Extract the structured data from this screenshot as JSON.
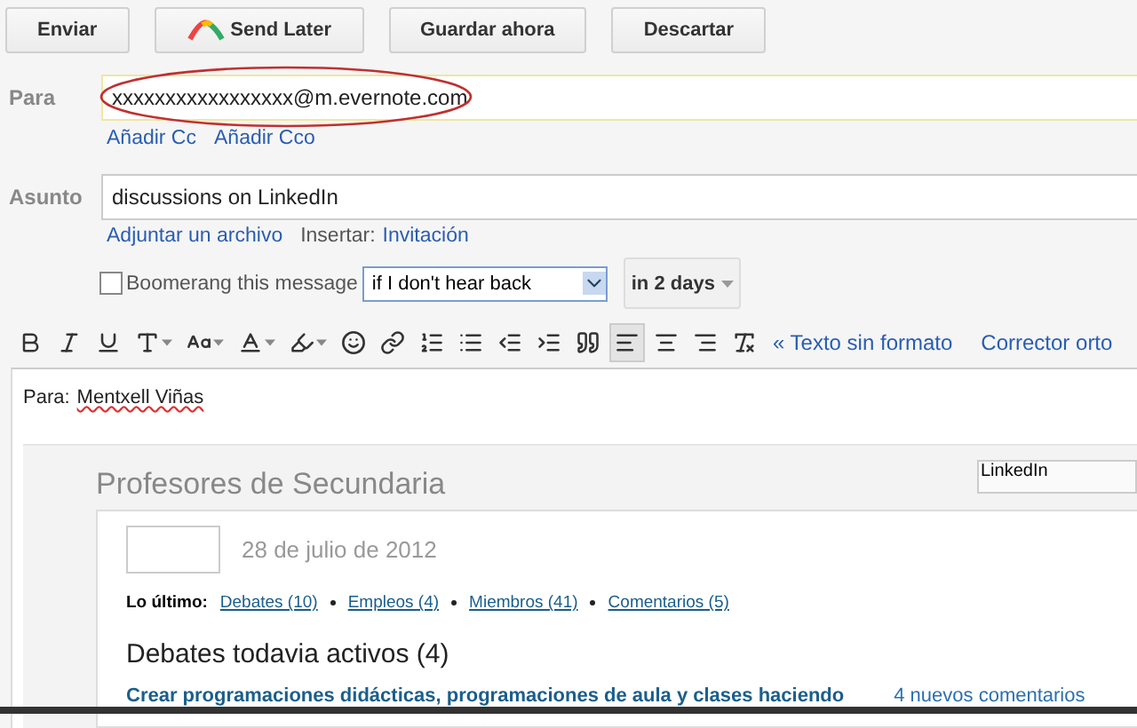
{
  "toolbar": {
    "buttons": [
      {
        "label": "Enviar",
        "kind": "plain"
      },
      {
        "label": "Send Later",
        "kind": "logo"
      },
      {
        "label": "Guardar ahora",
        "kind": "plain"
      },
      {
        "label": "Descartar",
        "kind": "plain"
      }
    ]
  },
  "to": {
    "label": "Para",
    "value": "xxxxxxxxxxxxxxxxx@m.evernote.com",
    "highlighted": true,
    "links": [
      "Añadir Cc",
      "Añadir Cco"
    ]
  },
  "subject": {
    "label": "Asunto",
    "value": "discussions on LinkedIn",
    "attach_link": "Adjuntar un archivo",
    "insert_label": "Insertar:",
    "insert_link": "Invitación"
  },
  "boomerang": {
    "checked": false,
    "label": "Boomerang this message",
    "condition": "if I don't hear back",
    "delay": "in 2 days"
  },
  "format_toolbar": {
    "buttons": [
      {
        "kind": "bold",
        "menu": false,
        "selected": false
      },
      {
        "kind": "italic",
        "menu": false,
        "selected": false
      },
      {
        "kind": "underline",
        "menu": false,
        "selected": false
      },
      {
        "kind": "font",
        "menu": true,
        "selected": false
      },
      {
        "kind": "size",
        "menu": true,
        "selected": false
      },
      {
        "kind": "color",
        "menu": true,
        "selected": false
      },
      {
        "kind": "highlight",
        "menu": true,
        "selected": false
      },
      {
        "kind": "emoji",
        "menu": false,
        "selected": false
      },
      {
        "kind": "link",
        "menu": false,
        "selected": false
      },
      {
        "kind": "numbered",
        "menu": false,
        "selected": false
      },
      {
        "kind": "bullets",
        "menu": false,
        "selected": false
      },
      {
        "kind": "outdent",
        "menu": false,
        "selected": false
      },
      {
        "kind": "indent",
        "menu": false,
        "selected": false
      },
      {
        "kind": "quote",
        "menu": false,
        "selected": false
      },
      {
        "kind": "align-left",
        "menu": false,
        "selected": true
      },
      {
        "kind": "align-center",
        "menu": false,
        "selected": false
      },
      {
        "kind": "align-right",
        "menu": false,
        "selected": false
      },
      {
        "kind": "clear",
        "menu": false,
        "selected": false
      }
    ],
    "links": [
      "« Texto sin formato",
      "Corrector orto"
    ]
  },
  "body": {
    "to_label": "Para:",
    "to_name": "Mentxell Viñas",
    "group": {
      "title": "Profesores de Secundaria",
      "badge": "LinkedIn",
      "date": "28 de julio de 2012",
      "latest_label": "Lo último:",
      "latest_links": [
        "Debates (10)",
        "Empleos (4)",
        "Miembros (41)",
        "Comentarios (5)"
      ],
      "heading": "Debates todavia activos (4)",
      "discussion": {
        "title": "Crear programaciones didácticas, programaciones de aula y clases haciendo",
        "comments": "4 nuevos comentarios"
      }
    }
  }
}
